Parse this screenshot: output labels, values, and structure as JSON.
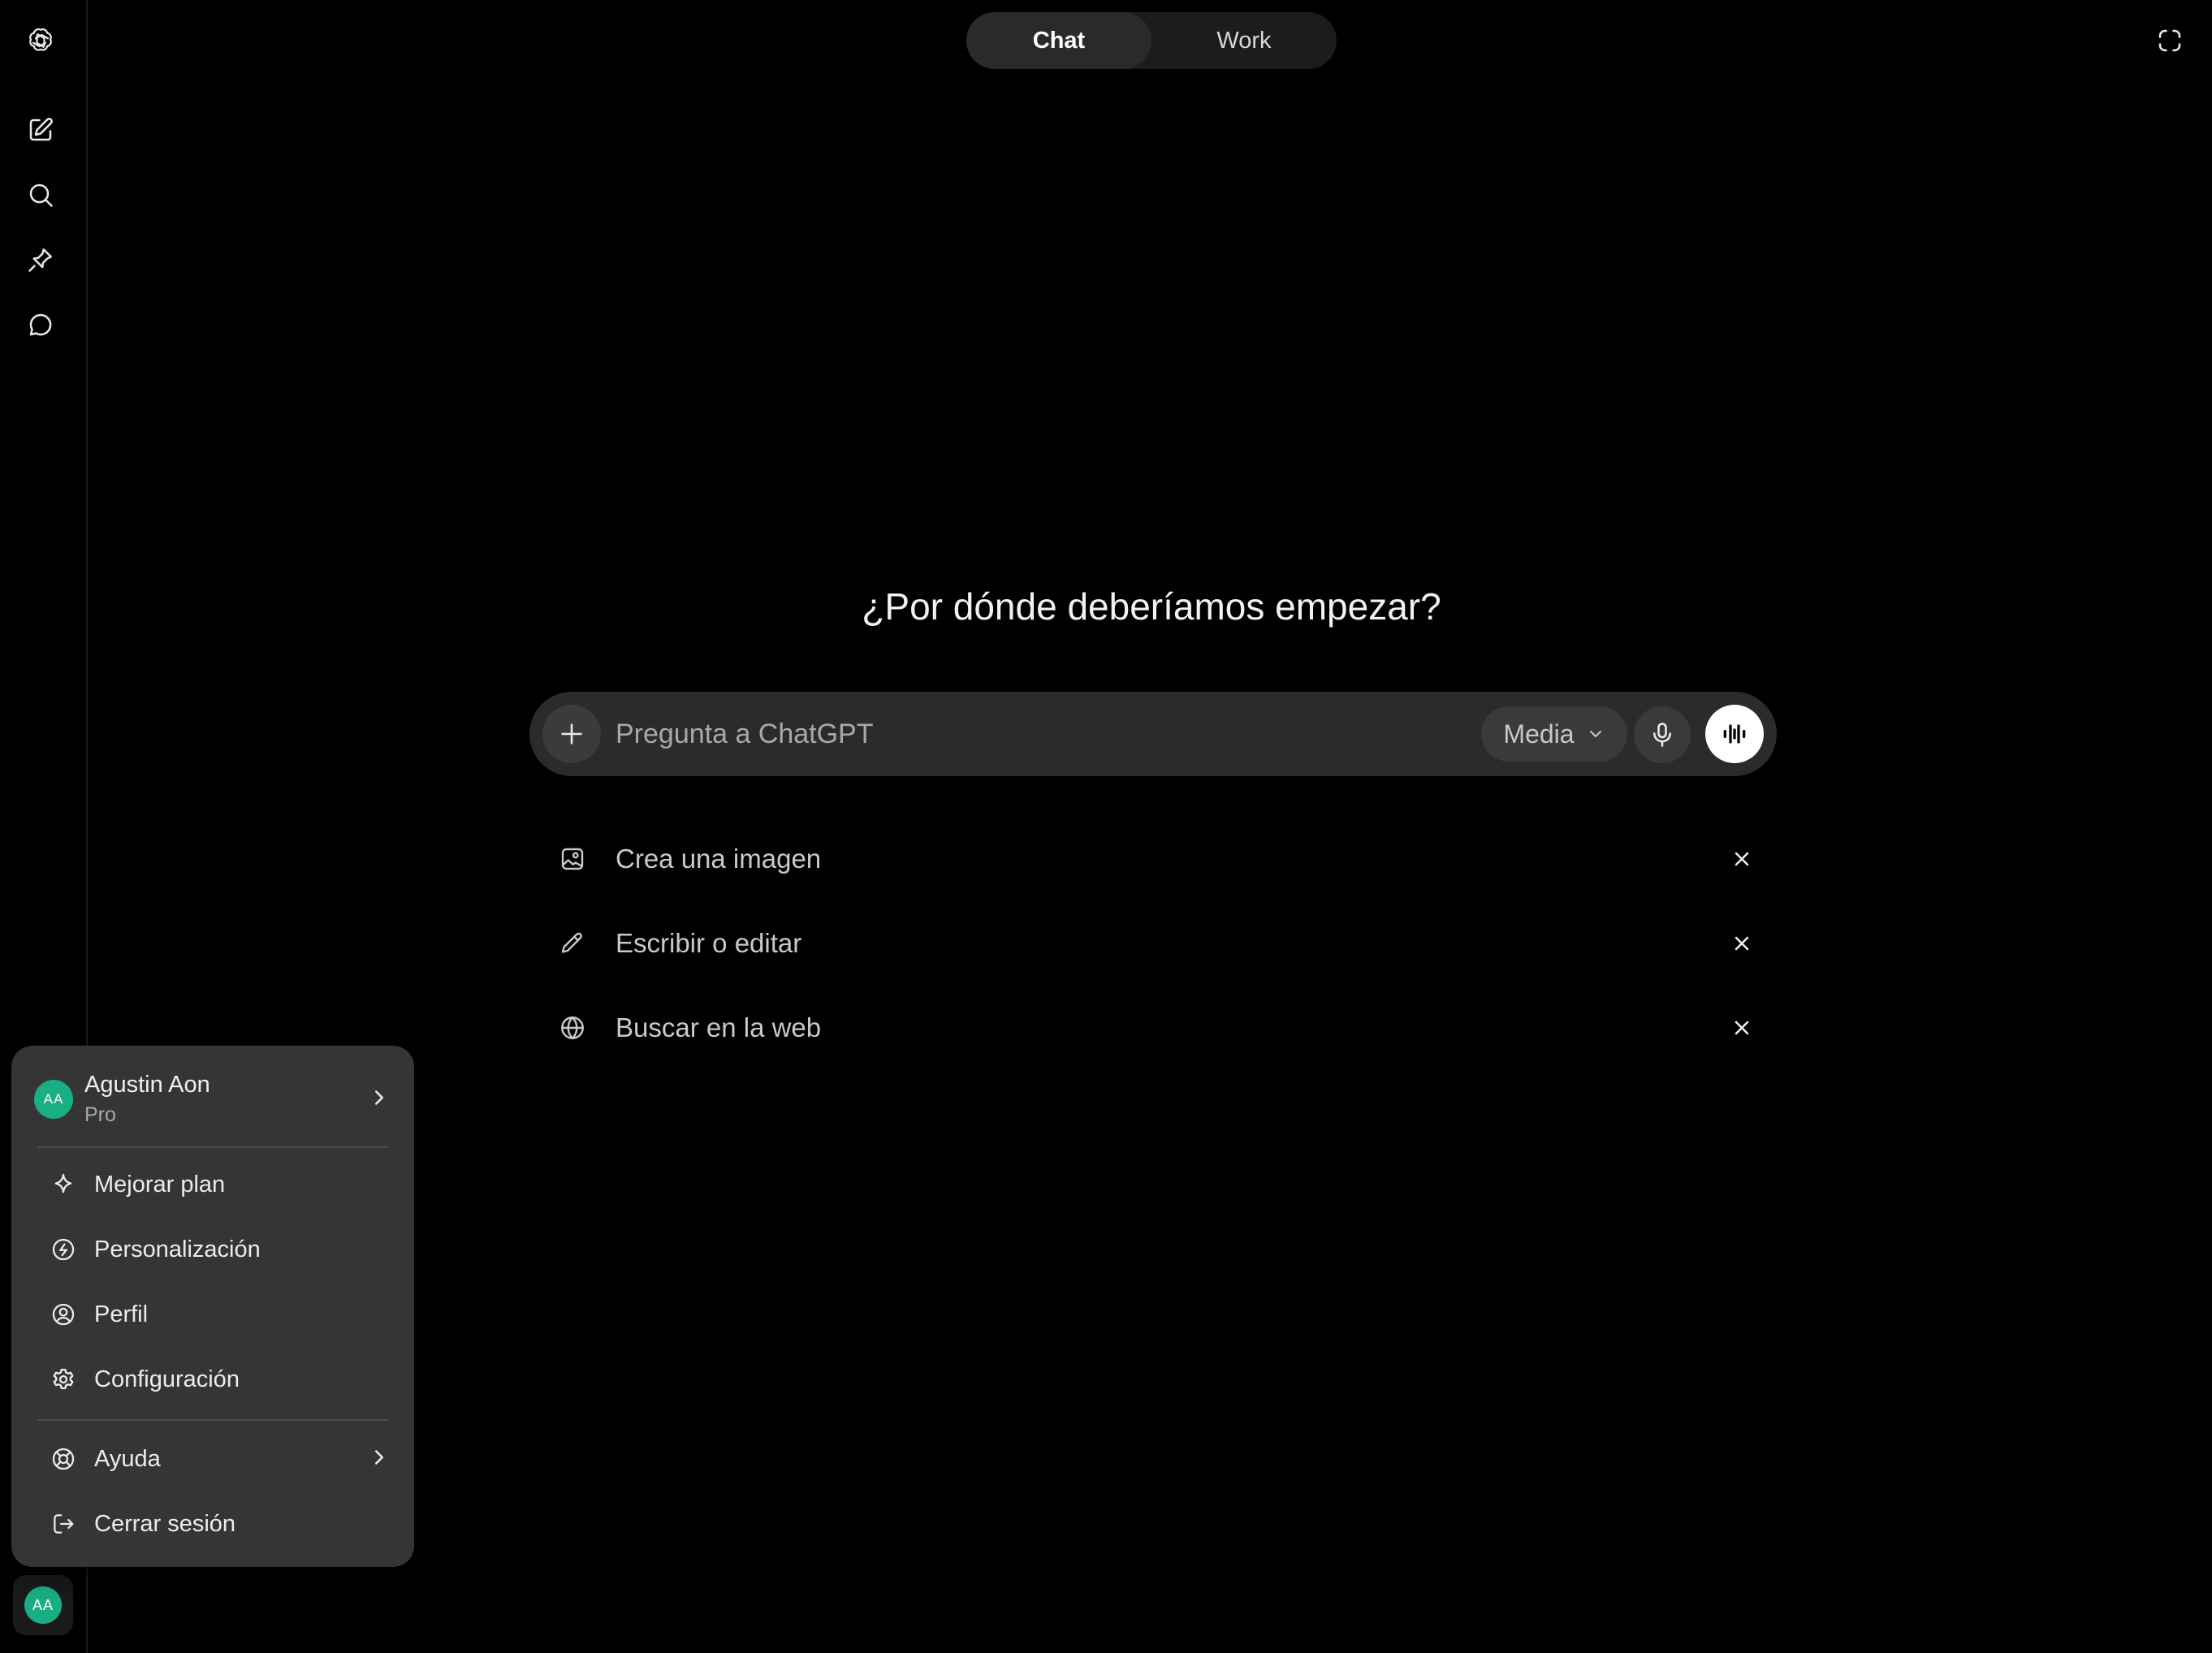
{
  "tabs": [
    {
      "label": "Chat",
      "active": true
    },
    {
      "label": "Work",
      "active": false
    }
  ],
  "sidebar": {
    "icons": [
      "chatgpt-logo-icon",
      "new-chat-icon",
      "search-icon",
      "pin-icon",
      "chat-bubble-icon"
    ],
    "avatar_initials": "AA"
  },
  "main": {
    "headline": "¿Por dónde deberíamos empezar?",
    "composer": {
      "placeholder": "Pregunta a ChatGPT",
      "value": "",
      "model_pill": "Media"
    },
    "suggestions": [
      {
        "label": "Crea una imagen",
        "icon": "image-icon"
      },
      {
        "label": "Escribir o editar",
        "icon": "pencil-icon"
      },
      {
        "label": "Buscar en la web",
        "icon": "globe-icon"
      }
    ]
  },
  "account_menu": {
    "user": {
      "initials": "AA",
      "name": "Agustin Aon",
      "plan": "Pro"
    },
    "items": [
      {
        "label": "Mejorar plan",
        "icon": "sparkle-icon"
      },
      {
        "label": "Personalización",
        "icon": "personalization-icon"
      },
      {
        "label": "Perfil",
        "icon": "profile-icon"
      },
      {
        "label": "Configuración",
        "icon": "gear-icon"
      }
    ],
    "help": {
      "label": "Ayuda",
      "icon": "lifebuoy-icon"
    },
    "logout": {
      "label": "Cerrar sesión",
      "icon": "logout-icon"
    }
  },
  "colors": {
    "background": "#000000",
    "surface": "#2b2b2b",
    "menu": "#353535",
    "avatar": "#1aae85",
    "text": "#ececec"
  }
}
